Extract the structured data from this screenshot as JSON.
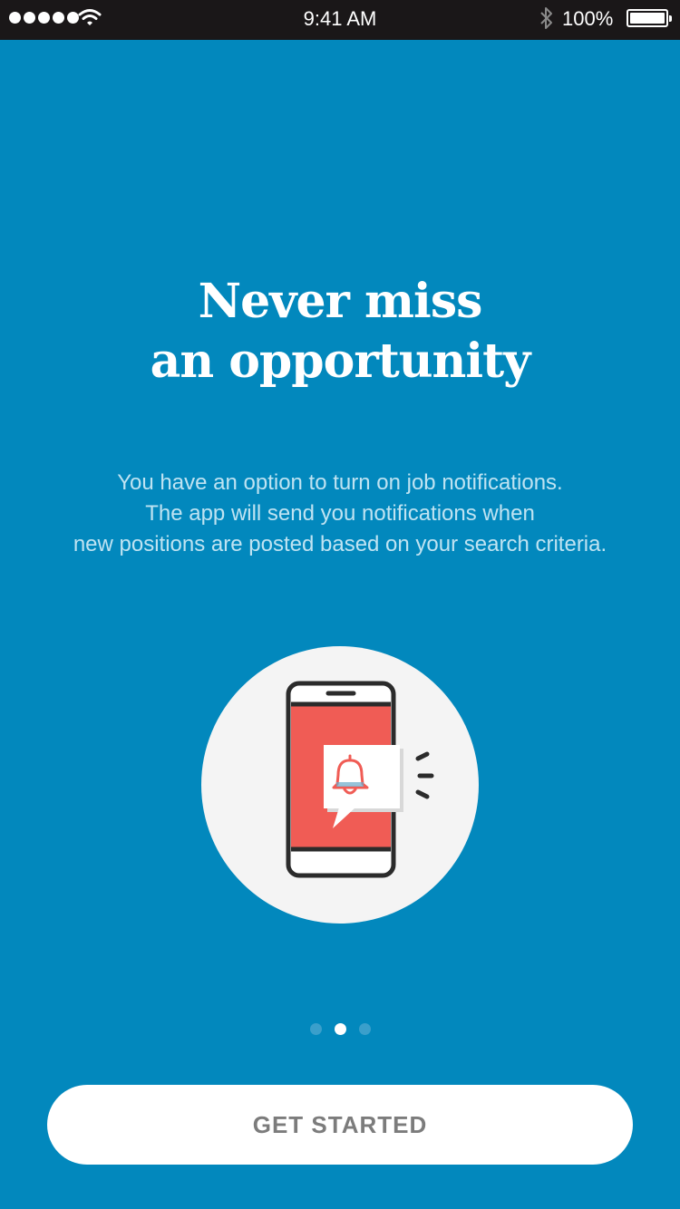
{
  "status_bar": {
    "time": "9:41 AM",
    "battery_percent": "100%",
    "signal_icon": "signal-dots-icon",
    "wifi_icon": "wifi-icon",
    "bluetooth_icon": "bluetooth-icon",
    "battery_icon": "battery-icon"
  },
  "onboarding": {
    "headline_line1": "Never miss",
    "headline_line2": "an opportunity",
    "description_line1": "You have an option to turn on job notifications.",
    "description_line2": "The app will send you notifications when",
    "description_line3": "new positions are posted based on your search criteria.",
    "illustration_icon": "phone-notification-bell-icon",
    "pager": {
      "total": 3,
      "active_index": 1
    },
    "cta_label": "GET STARTED"
  },
  "colors": {
    "background": "#0288bd",
    "status_bar": "#1a1718",
    "phone_screen": "#f05c55",
    "circle": "#f4f4f4",
    "button_text": "#7c7c7c"
  }
}
